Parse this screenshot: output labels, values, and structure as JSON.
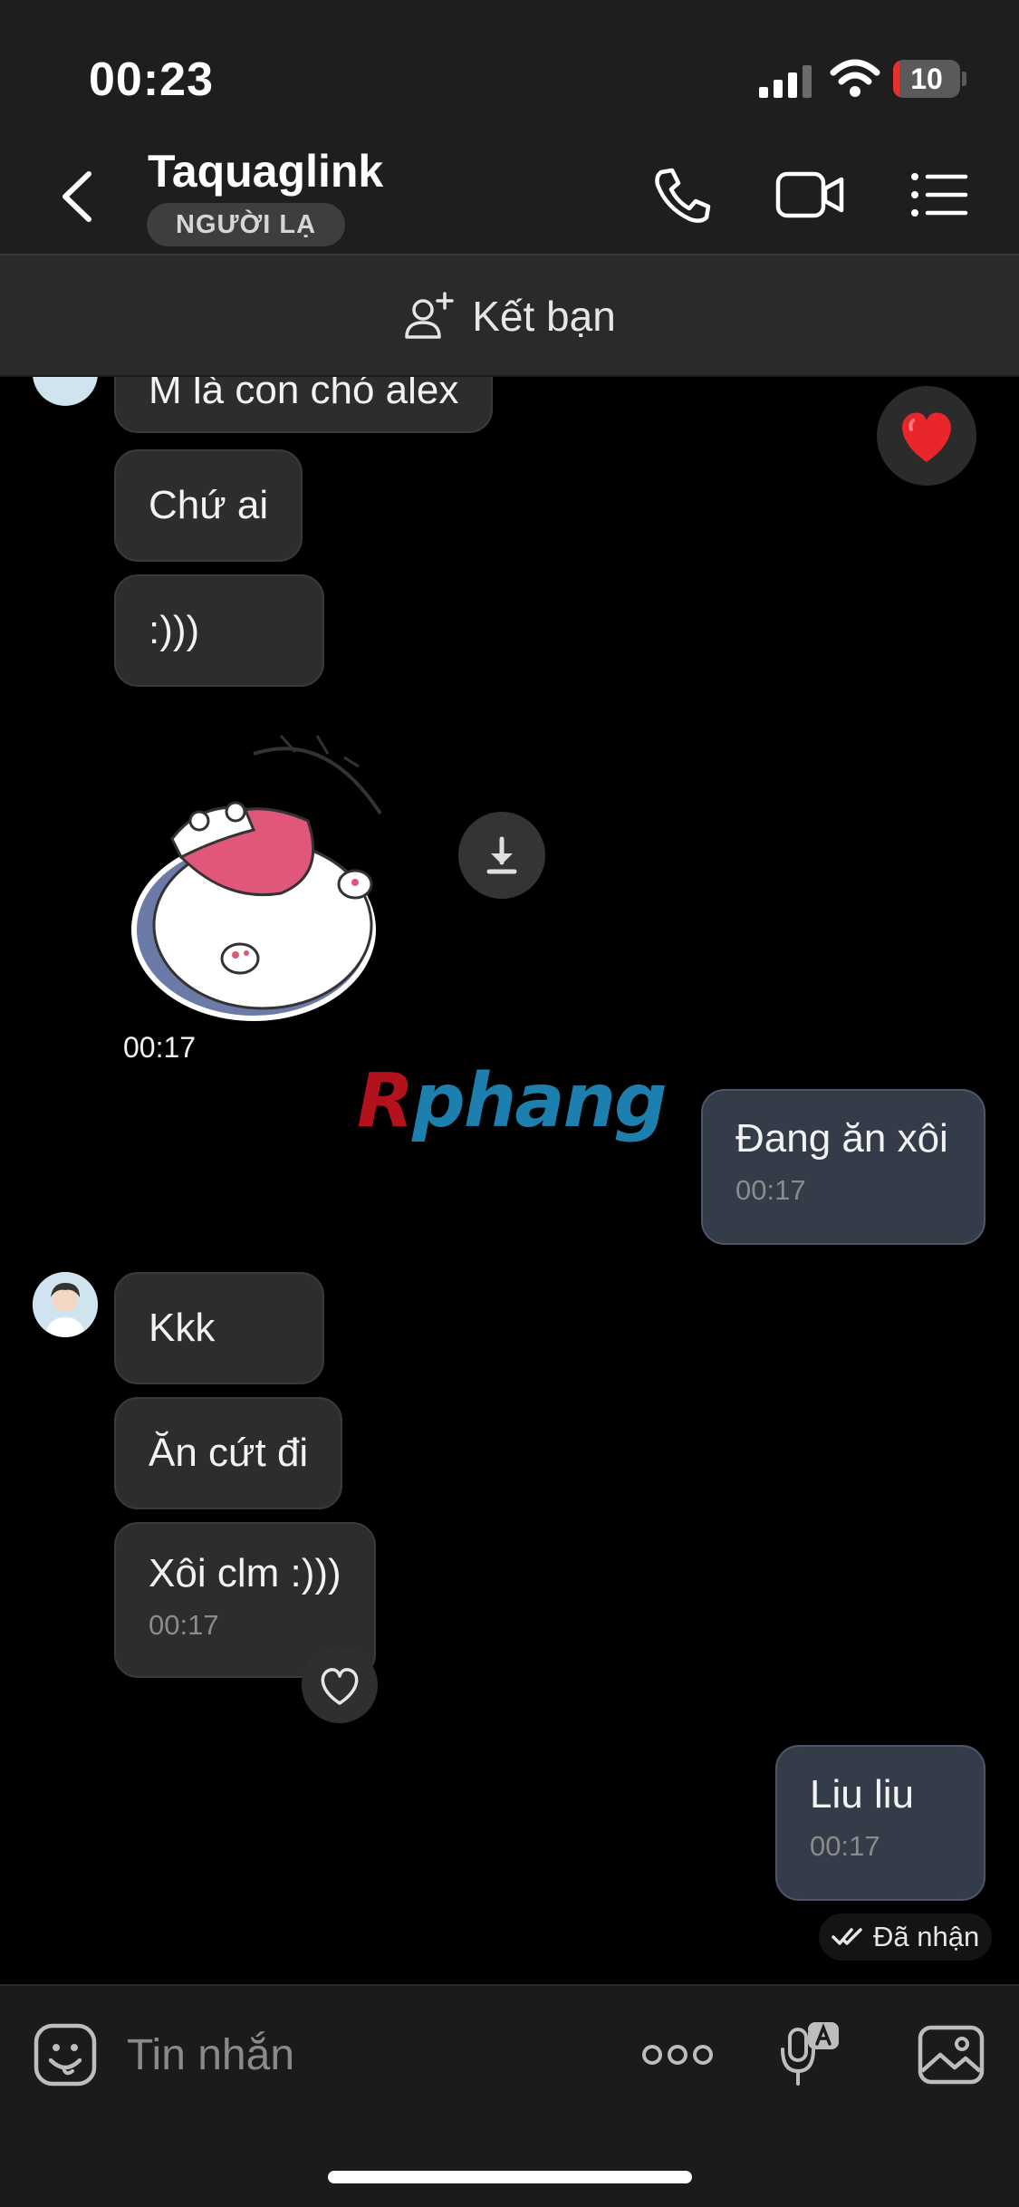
{
  "status_bar": {
    "time": "00:23",
    "battery": "10",
    "battery_level": 0.1
  },
  "header": {
    "contact_name": "Taquaglink",
    "badge": "NGƯỜI LẠ",
    "back_icon": "chevron-left-icon",
    "actions": [
      "phone-icon",
      "video-camera-icon",
      "menu-list-icon"
    ]
  },
  "add_friend": {
    "label": "Kết bạn",
    "icon": "add-user-icon"
  },
  "messages": {
    "partial": "M là con chó alex",
    "chu_ai": "Chứ ai",
    "smile": ":)))",
    "sticker_time": "00:17",
    "dang_an_xoi": {
      "text": "Đang ăn xôi",
      "time": "00:17"
    },
    "kkk": "Kkk",
    "an_cuc_di": "Ăn cứt đi",
    "xoi_clm": {
      "text": "Xôi clm :)))",
      "time": "00:17"
    },
    "liu_liu": {
      "text": "Liu liu",
      "time": "00:17"
    },
    "receipt": "Đã nhận"
  },
  "watermark": {
    "part1": "R",
    "part2": "phang"
  },
  "composer": {
    "placeholder": "Tin nhắn"
  },
  "colors": {
    "background": "#000000",
    "bar": "#1e1e1e",
    "incoming_bubble": "#2d2d2d",
    "outgoing_bubble": "#343c49",
    "heart": "#e8262b"
  }
}
